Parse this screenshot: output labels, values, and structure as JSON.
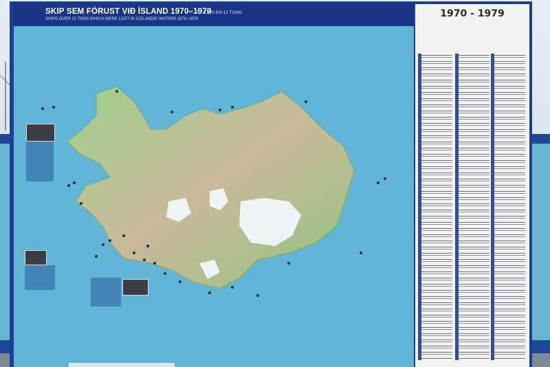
{
  "sign": {
    "title": "SKIP SEM FÓRUST VIÐ ÍSLAND 1970–1979",
    "subtitle": "SHIPS OVER 12 TONS WHICH WERE LOST IN ICELANDIC WATERS 1970–1979",
    "size_note": "STÆRRI EN 12 TONN",
    "list_heading": "1970 - 1979"
  },
  "colors": {
    "frame": "#1d3f8f",
    "sea": "#61b5d6",
    "panel": "#f2f3f0"
  }
}
